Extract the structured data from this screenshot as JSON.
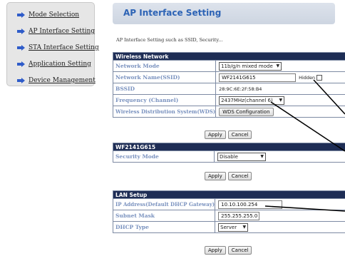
{
  "sidebar": {
    "items": [
      {
        "label": "Mode Selection"
      },
      {
        "label": "AP Interface Setting"
      },
      {
        "label": "STA Interface Setting"
      },
      {
        "label": "Application Setting"
      },
      {
        "label": "Device Management"
      }
    ]
  },
  "header": {
    "title": "AP Interface Setting"
  },
  "description": "AP Interface Setting such as SSID, Security...",
  "wireless": {
    "title": "Wireless Network",
    "network_mode_label": "Network Mode",
    "network_mode_value": "11b/g/n mixed mode",
    "ssid_label": "Network Name(SSID)",
    "ssid_value": "WF2141G615",
    "hidden_label": "Hidden",
    "bssid_label": "BSSID",
    "bssid_value": "28:9C:6E:2F:58:B4",
    "frequency_label": "Frequency (Channel)",
    "frequency_value": "2437MHz(channel 6)",
    "wds_label": "Wireless Distribution System(WDS)",
    "wds_button": "WDS Configuration"
  },
  "security": {
    "title": "WF2141G615",
    "mode_label": "Security Mode",
    "mode_value": "Disable"
  },
  "lan": {
    "title": "LAN Setup",
    "ip_label": "IP Address(Default DHCP Gateway)",
    "ip_value": "10.10.100.254",
    "mask_label": "Subnet Mask",
    "mask_value": "255.255.255.0",
    "dhcp_label": "DHCP Type",
    "dhcp_value": "Server"
  },
  "buttons": {
    "apply": "Apply",
    "cancel": "Cancel"
  }
}
